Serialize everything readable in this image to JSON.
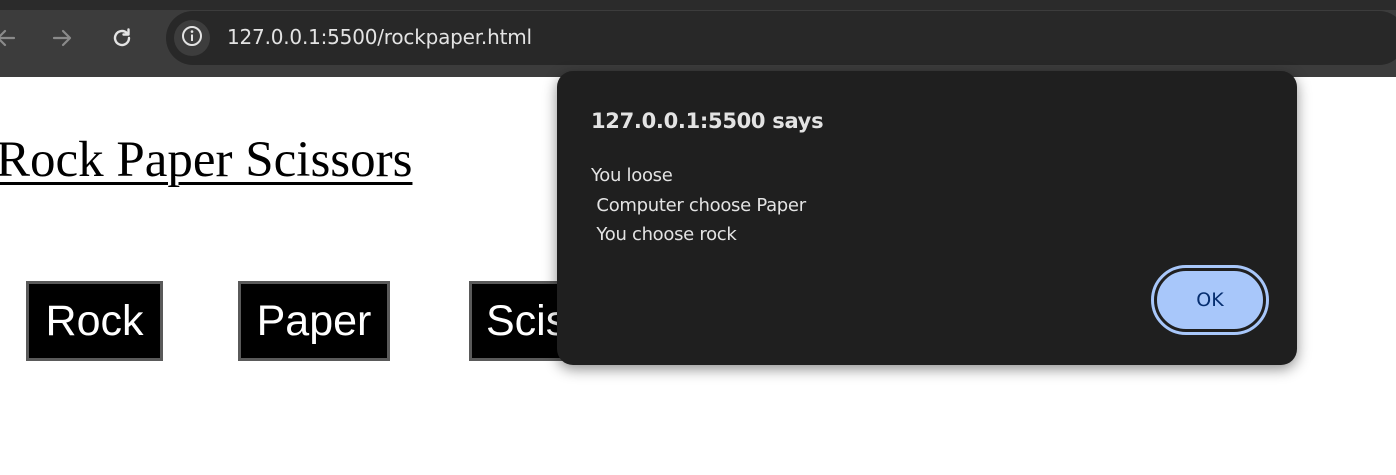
{
  "browser": {
    "url": "127.0.0.1:5500/rockpaper.html",
    "icons": {
      "back": "arrow-left-icon",
      "forward": "arrow-right-icon",
      "reload": "reload-icon",
      "info": "info-icon"
    }
  },
  "page": {
    "title": "Rock Paper Scissors",
    "buttons": {
      "rock": "Rock",
      "paper": "Paper",
      "scissors": "Scissors"
    }
  },
  "dialog": {
    "title": "127.0.0.1:5500 says",
    "message": "You loose\n Computer choose Paper\n You choose rock",
    "ok_label": "OK"
  },
  "colors": {
    "chrome_bg": "#3c3c3c",
    "address_bg": "#282828",
    "dialog_bg": "#1f1f1f",
    "ok_button_bg": "#a8c7fa",
    "ok_button_text": "#062e6f"
  }
}
